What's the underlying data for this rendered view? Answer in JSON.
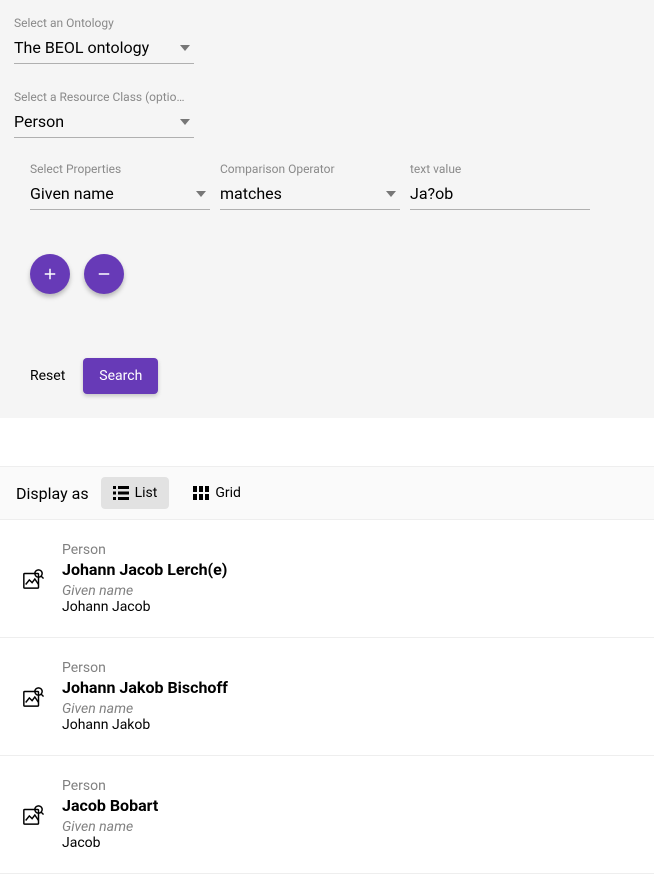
{
  "ontology_select": {
    "label": "Select an Ontology",
    "value": "The BEOL ontology"
  },
  "class_select": {
    "label": "Select a Resource Class (optio…",
    "value": "Person"
  },
  "property_select": {
    "label": "Select Properties",
    "value": "Given name"
  },
  "operator_select": {
    "label": "Comparison Operator",
    "value": "matches"
  },
  "text_value": {
    "label": "text value",
    "value": "Ja?ob"
  },
  "reset_label": "Reset",
  "search_label": "Search",
  "display_as_label": "Display as",
  "view_list_label": "List",
  "view_grid_label": "Grid",
  "results": [
    {
      "type": "Person",
      "title": "Johann Jacob Lerch(e)",
      "prop": "Given name",
      "value": "Johann Jacob"
    },
    {
      "type": "Person",
      "title": "Johann Jakob Bischoff",
      "prop": "Given name",
      "value": "Johann Jakob"
    },
    {
      "type": "Person",
      "title": "Jacob Bobart",
      "prop": "Given name",
      "value": "Jacob"
    }
  ]
}
